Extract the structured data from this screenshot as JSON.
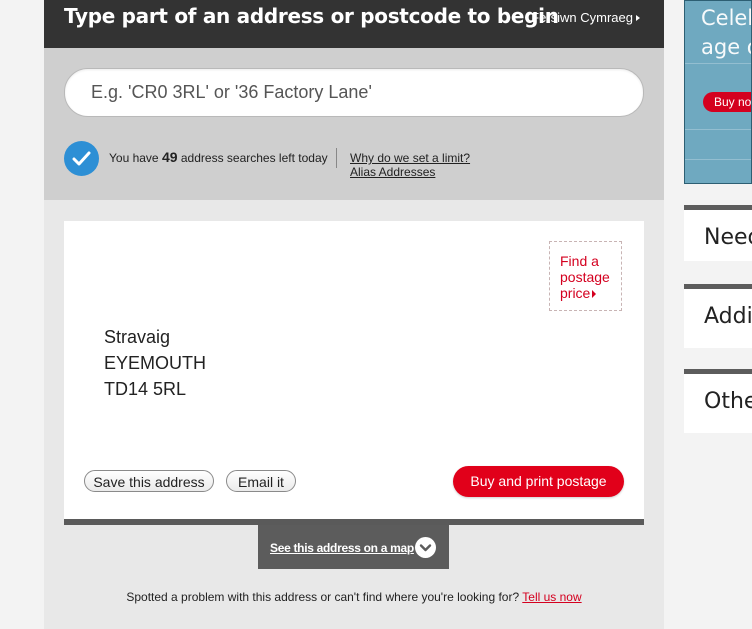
{
  "header": {
    "title": "Type part of an address or postcode to begin",
    "language_link": "Fersiwn Cymraeg"
  },
  "search": {
    "placeholder": "E.g. 'CR0 3RL' or '36 Factory Lane'",
    "value": "",
    "remaining_prefix": "You have",
    "remaining_count": "49",
    "remaining_suffix": "address searches left today",
    "why_limit_link": "Why do we set a limit?",
    "alias_link": "Alias Addresses"
  },
  "result": {
    "postage_price_link": "Find a postage price",
    "address_lines": [
      "Stravaig",
      "EYEMOUTH",
      "TD14 5RL"
    ],
    "save_label": "Save this address",
    "email_label": "Email it",
    "buy_label": "Buy and print postage",
    "map_link": "See this address on a map"
  },
  "problem": {
    "text": "Spotted a problem with this address or can't find where you're looking for?",
    "link": "Tell us now"
  },
  "sidebar": {
    "promo_line1": "Celeb",
    "promo_line2": "age o",
    "promo_button": "Buy no",
    "boxes": [
      "Need",
      "Addit",
      "Other"
    ]
  },
  "colors": {
    "header_bg": "#333333",
    "accent_red": "#e1001a",
    "check_blue": "#2d8fd5"
  },
  "icons": [
    "check-icon",
    "caret-right-icon",
    "chevron-down-icon"
  ]
}
